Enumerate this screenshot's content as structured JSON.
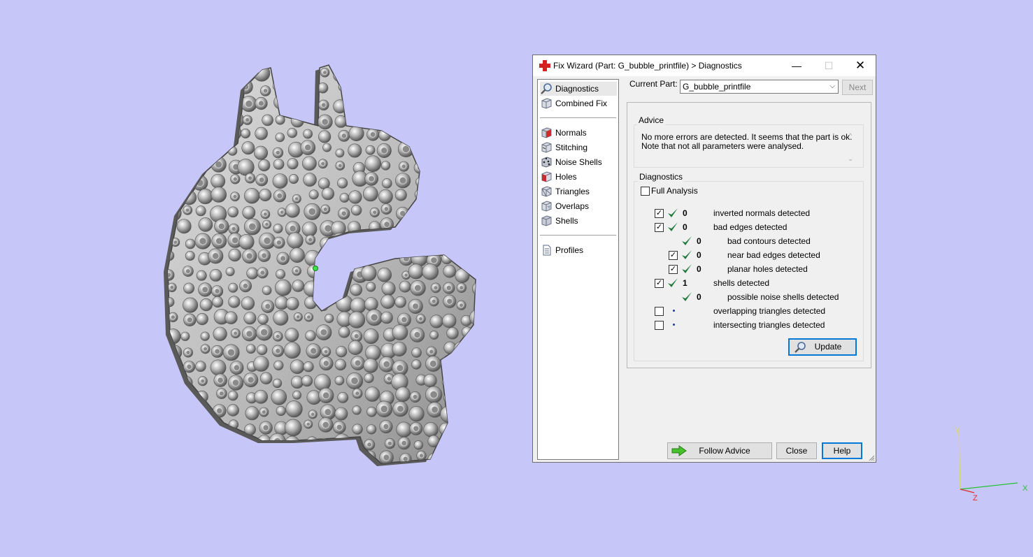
{
  "dialog": {
    "title": "Fix Wizard (Part: G_bubble_printfile) > Diagnostics",
    "minimize_glyph": "—",
    "maximize_glyph": "☐",
    "close_glyph": "✕"
  },
  "nav": {
    "items": [
      {
        "label": "Diagnostics",
        "icon": "magnifier-icon"
      },
      {
        "label": "Combined Fix",
        "icon": "cube-icon"
      },
      {
        "label": "Normals",
        "icon": "normals-cube-icon"
      },
      {
        "label": "Stitching",
        "icon": "stitching-cube-icon"
      },
      {
        "label": "Noise Shells",
        "icon": "dice-icon"
      },
      {
        "label": "Holes",
        "icon": "holes-cube-icon"
      },
      {
        "label": "Triangles",
        "icon": "triangles-cube-icon"
      },
      {
        "label": "Overlaps",
        "icon": "overlaps-cube-icon"
      },
      {
        "label": "Shells",
        "icon": "shells-cube-icon"
      },
      {
        "label": "Profiles",
        "icon": "document-icon"
      }
    ]
  },
  "current_part": {
    "label": "Current Part:",
    "value": "G_bubble_printfile",
    "next_label": "Next"
  },
  "advice": {
    "title": "Advice",
    "line1": "No more errors are detected. It seems that the part is ok.",
    "line2": "Note that not all parameters were analysed."
  },
  "diagnostics": {
    "title": "Diagnostics",
    "full_analysis_label": "Full Analysis",
    "rows": [
      {
        "checked": true,
        "status": "ok",
        "count": "0",
        "label": "inverted normals detected"
      },
      {
        "checked": true,
        "status": "ok",
        "count": "0",
        "label": "bad edges detected"
      },
      {
        "checked": null,
        "status": "ok",
        "count": "0",
        "label": "bad contours detected"
      },
      {
        "checked": true,
        "status": "ok",
        "count": "0",
        "label": "near bad edges detected"
      },
      {
        "checked": true,
        "status": "ok",
        "count": "0",
        "label": "planar holes detected"
      },
      {
        "checked": true,
        "status": "ok",
        "count": "1",
        "label": "shells detected"
      },
      {
        "checked": null,
        "status": "ok",
        "count": "0",
        "label": "possible noise shells detected"
      },
      {
        "checked": false,
        "status": "pending",
        "count": "",
        "label": "overlapping triangles detected"
      },
      {
        "checked": false,
        "status": "pending",
        "count": "",
        "label": "intersecting triangles detected"
      }
    ],
    "update_label": "Update"
  },
  "footer": {
    "follow_advice_label": "Follow Advice",
    "close_label": "Close",
    "help_label": "Help"
  },
  "axis": {
    "x": "X",
    "y": "Y",
    "z": "Z"
  },
  "colors": {
    "background": "#c6c6f9",
    "check_green": "#1f7a3a",
    "accent_blue": "#0078d7"
  }
}
